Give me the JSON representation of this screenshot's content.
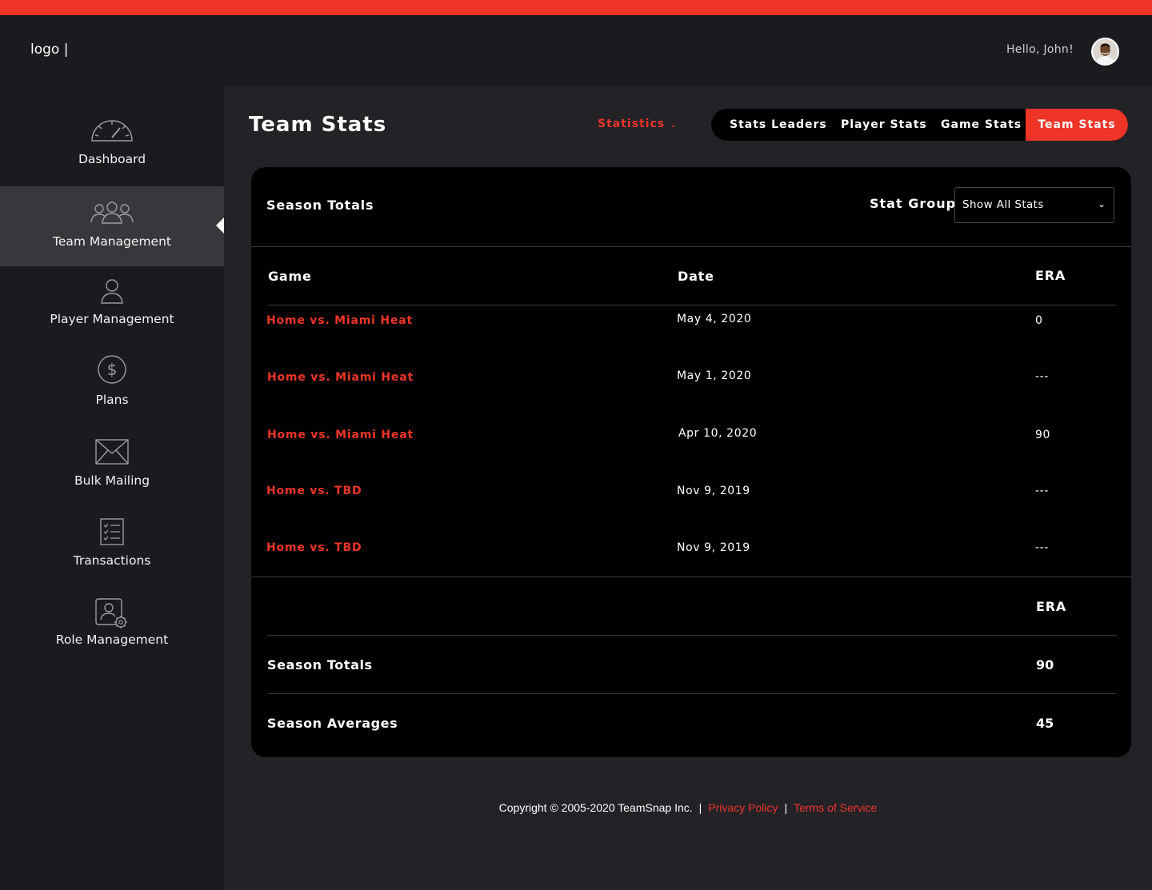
{
  "header": {
    "logo": "logo |",
    "greeting": "Hello, John!"
  },
  "sidebar": {
    "items": [
      {
        "label": "Dashboard",
        "icon": "speedometer-icon"
      },
      {
        "label": "Team Management",
        "icon": "team-icon"
      },
      {
        "label": "Player Management",
        "icon": "person-icon"
      },
      {
        "label": "Plans",
        "icon": "dollar-icon"
      },
      {
        "label": "Bulk Mailing",
        "icon": "envelope-icon"
      },
      {
        "label": "Transactions",
        "icon": "checklist-icon"
      },
      {
        "label": "Role Management",
        "icon": "user-settings-icon"
      }
    ],
    "active_index": 1
  },
  "page": {
    "title": "Team Stats",
    "dropdown_label": "Statistics",
    "tabs": [
      "Stats Leaders",
      "Player Stats",
      "Game Stats",
      "Team Stats"
    ],
    "active_tab": "Team Stats"
  },
  "card": {
    "title": "Season Totals",
    "stat_group_label": "Stat Group",
    "stat_group_value": "Show All Stats",
    "columns": [
      "Game",
      "Date",
      "ERA"
    ],
    "rows": [
      {
        "game": "Home vs. Miami Heat",
        "date": "May 4, 2020",
        "era": "0"
      },
      {
        "game": "Home vs. Miami Heat",
        "date": "May 1, 2020",
        "era": "---"
      },
      {
        "game": "Home vs. Miami Heat",
        "date": "Apr 10, 2020",
        "era": "90"
      },
      {
        "game": "Home vs. TBD",
        "date": "Nov 9, 2019",
        "era": "---"
      },
      {
        "game": "Home vs. TBD",
        "date": "Nov 9, 2019",
        "era": "---"
      }
    ],
    "summary_header": "ERA",
    "season_totals_label": "Season Totals",
    "season_totals_value": "90",
    "season_averages_label": "Season Averages",
    "season_averages_value": "45"
  },
  "footer": {
    "copyright": "Copyright © 2005-2020 TeamSnap Inc.",
    "separator": "|",
    "privacy": "Privacy Policy",
    "terms": "Terms of Service"
  },
  "colors": {
    "accent": "#ee3528",
    "sidebar_bg": "#1a1a1f",
    "main_bg": "#222227",
    "card_bg": "#000000",
    "active_nav_bg": "#38383c"
  }
}
